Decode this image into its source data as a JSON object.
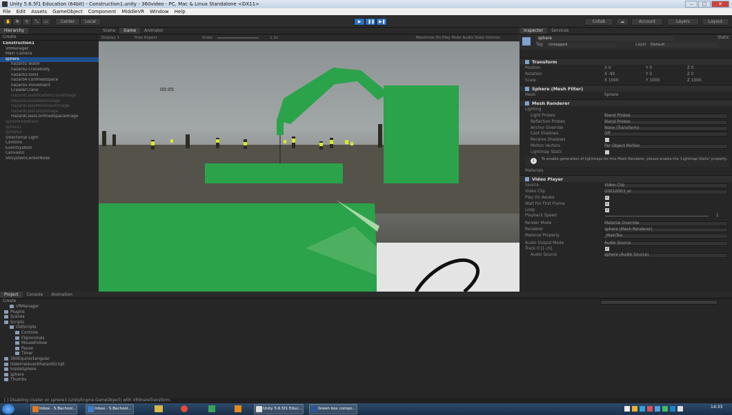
{
  "title_bar": "Unity 5.6.5f1 Education (64bit) - Construction1.unity - 360video - PC, Mac & Linux Standalone <DX11>",
  "menu": [
    "File",
    "Edit",
    "Assets",
    "GameObject",
    "Component",
    "MiddleVR",
    "Window",
    "Help"
  ],
  "toolbar": {
    "center": "Center",
    "local": "Local",
    "collab": "Collab",
    "account": "Account",
    "layers": "Layers",
    "layout": "Layout"
  },
  "hierarchy": {
    "tab": "Hierarchy",
    "create": "Create",
    "items": [
      {
        "label": "Construction1",
        "cls": "scene-root"
      },
      {
        "label": "VRManager",
        "cls": ""
      },
      {
        "label": "Main Camera",
        "cls": ""
      },
      {
        "label": "sphere",
        "cls": "sel"
      },
      {
        "label": "hazard1-water",
        "cls": "ind"
      },
      {
        "label": "hazard2-cranebody",
        "cls": "ind"
      },
      {
        "label": "hazard3-tools",
        "cls": "ind"
      },
      {
        "label": "hazard4-confinedSpace",
        "cls": "ind"
      },
      {
        "label": "hazard5-movement",
        "cls": "ind"
      },
      {
        "label": "CrawlerCrane",
        "cls": "ind"
      },
      {
        "label": "HazardClassificationCraneImage",
        "cls": "ind dim"
      },
      {
        "label": "HazardClassWaterImage",
        "cls": "ind dim"
      },
      {
        "label": "HazardClassMovementImage",
        "cls": "ind dim"
      },
      {
        "label": "HazardClassToolsImage",
        "cls": "ind dim"
      },
      {
        "label": "HazardClassConfinedSpaceImage",
        "cls": "ind"
      },
      {
        "label": "sphereFeedback",
        "cls": "dim"
      },
      {
        "label": "sphere1",
        "cls": "dim"
      },
      {
        "label": "sphere3",
        "cls": "dim"
      },
      {
        "label": "Directional Light",
        "cls": ""
      },
      {
        "label": "Controls",
        "cls": ""
      },
      {
        "label": "EventSystem",
        "cls": ""
      },
      {
        "label": "CanvasUI",
        "cls": ""
      },
      {
        "label": "VRSystemCenterNode",
        "cls": ""
      }
    ]
  },
  "scene": {
    "tabs": [
      "Scene",
      "Game",
      "Animator"
    ],
    "display": "Display 1",
    "aspect": "Free Aspect",
    "scale_label": "Scale",
    "scale_value": "1.1x",
    "options": "Maximize On Play   Mute Audio   Stats   Gizmos",
    "timer": "00:05"
  },
  "inspector": {
    "tabs": [
      "Inspector",
      "Services"
    ],
    "object_name": "sphere",
    "static": "Static",
    "tag_label": "Tag",
    "tag_value": "Untagged",
    "layer_label": "Layer",
    "layer_value": "Default",
    "transform": "Transform",
    "position": {
      "label": "Position",
      "x": "X 0",
      "y": "Y 0",
      "z": "Z 0"
    },
    "rotation": {
      "label": "Rotation",
      "x": "X -90",
      "y": "Y 0",
      "z": "Z 0"
    },
    "scale": {
      "label": "Scale",
      "x": "X 1000",
      "y": "Y 1000",
      "z": "Z 1000"
    },
    "mesh_filter": "Sphere (Mesh Filter)",
    "mesh_label": "Mesh",
    "mesh_value": "Sphere",
    "mesh_renderer": "Mesh Renderer",
    "lighting": "Lighting",
    "light_probes": {
      "label": "Light Probes",
      "value": "Blend Probes"
    },
    "reflection_probes": {
      "label": "Reflection Probes",
      "value": "Blend Probes"
    },
    "anchor_override": {
      "label": "Anchor Override",
      "value": "None (Transform)"
    },
    "cast_shadows": {
      "label": "Cast Shadows",
      "value": "Off"
    },
    "receive_shadows": {
      "label": "Receive Shadows"
    },
    "motion_vectors": {
      "label": "Motion Vectors",
      "value": "Per Object Motion"
    },
    "lightmap_static": {
      "label": "Lightmap Static"
    },
    "info": "To enable generation of lightmaps for this Mesh Renderer, please enable the 'Lightmap Static' property.",
    "materials": "Materials",
    "video_player": "Video Player",
    "source": {
      "label": "Source",
      "value": "Video Clip"
    },
    "video_clip": {
      "label": "Video Clip",
      "value": "G0010003_er"
    },
    "play_on_awake": {
      "label": "Play On Awake"
    },
    "wait_first_frame": {
      "label": "Wait For First Frame"
    },
    "loop": {
      "label": "Loop"
    },
    "playback_speed": {
      "label": "Playback Speed",
      "value": "1"
    },
    "render_mode": {
      "label": "Render Mode",
      "value": "Material Override"
    },
    "renderer": {
      "label": "Renderer",
      "value": "sphere (Mesh Renderer)"
    },
    "material_property": {
      "label": "Material Property",
      "value": "_MainTex"
    },
    "audio_output": {
      "label": "Audio Output Mode",
      "value": "Audio Source"
    },
    "track": {
      "label": "Track 0 [1 ch]"
    },
    "audio_source": {
      "label": "Audio Source",
      "value": "sphere (Audio Source)"
    }
  },
  "project": {
    "tabs": [
      "Project",
      "Console",
      "Animation"
    ],
    "create": "Create",
    "items": [
      {
        "label": "VRManager",
        "indent": 1
      },
      {
        "label": "Plugins",
        "indent": 0
      },
      {
        "label": "Scenes",
        "indent": 0
      },
      {
        "label": "Scripts",
        "indent": 0
      },
      {
        "label": "OldScripts",
        "indent": 1
      },
      {
        "label": "Controls",
        "indent": 2
      },
      {
        "label": "Flipnormals",
        "indent": 2
      },
      {
        "label": "MouseFollow",
        "indent": 2
      },
      {
        "label": "Pause",
        "indent": 2
      },
      {
        "label": "Timer",
        "indent": 2
      },
      {
        "label": "360Equirectangular",
        "indent": 0
      },
      {
        "label": "HideIrrelevantHazardScript",
        "indent": 0
      },
      {
        "label": "InsideSphere",
        "indent": 0
      },
      {
        "label": "sphere",
        "indent": 0
      },
      {
        "label": "Thumbs",
        "indent": 0
      }
    ]
  },
  "status": "[ ] Disabling cluster on sphere3 (UnityEngine.GameObject) with VRShareTransform.",
  "taskbar": {
    "tasks": [
      "Inbox - S.Bachool...",
      "Inbox - S.Bachool...",
      "Unity 5.6.5f1 Educ...",
      "Green box compo..."
    ],
    "time": "14:33"
  },
  "colors": {
    "green": "#2aa34a",
    "selection": "#1f4f8a",
    "panel": "#262626"
  }
}
